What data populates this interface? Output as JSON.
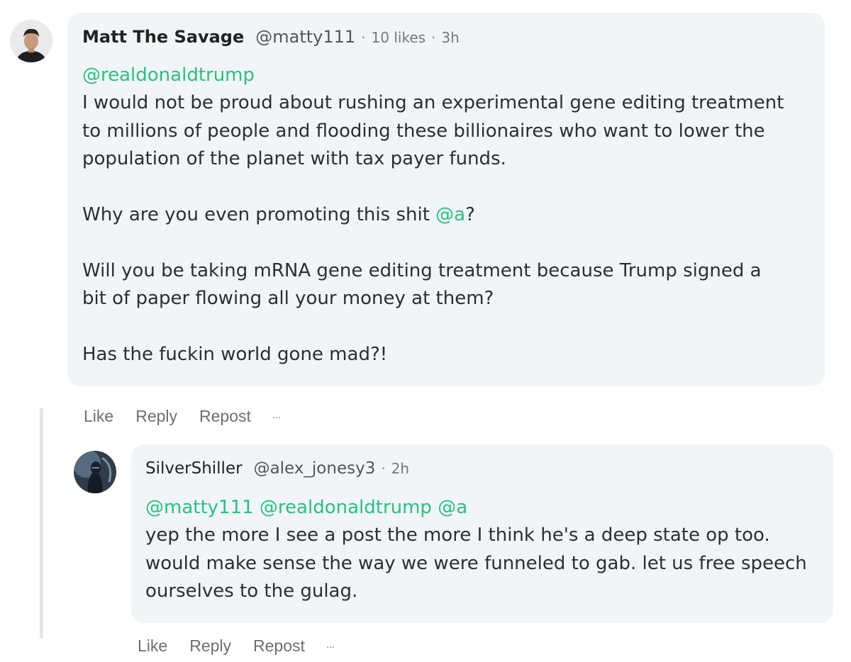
{
  "comments": [
    {
      "author": "Matt The Savage",
      "handle": "@matty111",
      "likes": "10 likes",
      "time": "3h",
      "mention": "@realdonaldtrump",
      "lines": [
        "I would not be proud about rushing an experimental gene editing treatment",
        "to millions of people and flooding these billionaires who want to lower the",
        "population of the planet with tax payer funds."
      ],
      "line2_prefix": "Why are you even promoting this shit ",
      "line2_mention": "@a",
      "line2_suffix": "?",
      "lines3": [
        "Will you be taking mRNA gene editing treatment because Trump signed a",
        "bit of paper flowing all your money at them?"
      ],
      "line4": "Has the fuckin world gone mad?!"
    },
    {
      "author": "SilverShiller",
      "handle": "@alex_jonesy3",
      "time": "2h",
      "mentions": "@matty111 @realdonaldtrump @a",
      "lines": [
        "yep the more I see a post the more I think he's a deep state op too.",
        "would make sense the way we were funneled to gab. let us free speech",
        "ourselves to the gulag."
      ]
    }
  ],
  "actions": {
    "like": "Like",
    "reply": "Reply",
    "repost": "Repost",
    "more": "···"
  },
  "colors": {
    "mention": "#27c27f",
    "bubble": "#f2f5f8"
  }
}
